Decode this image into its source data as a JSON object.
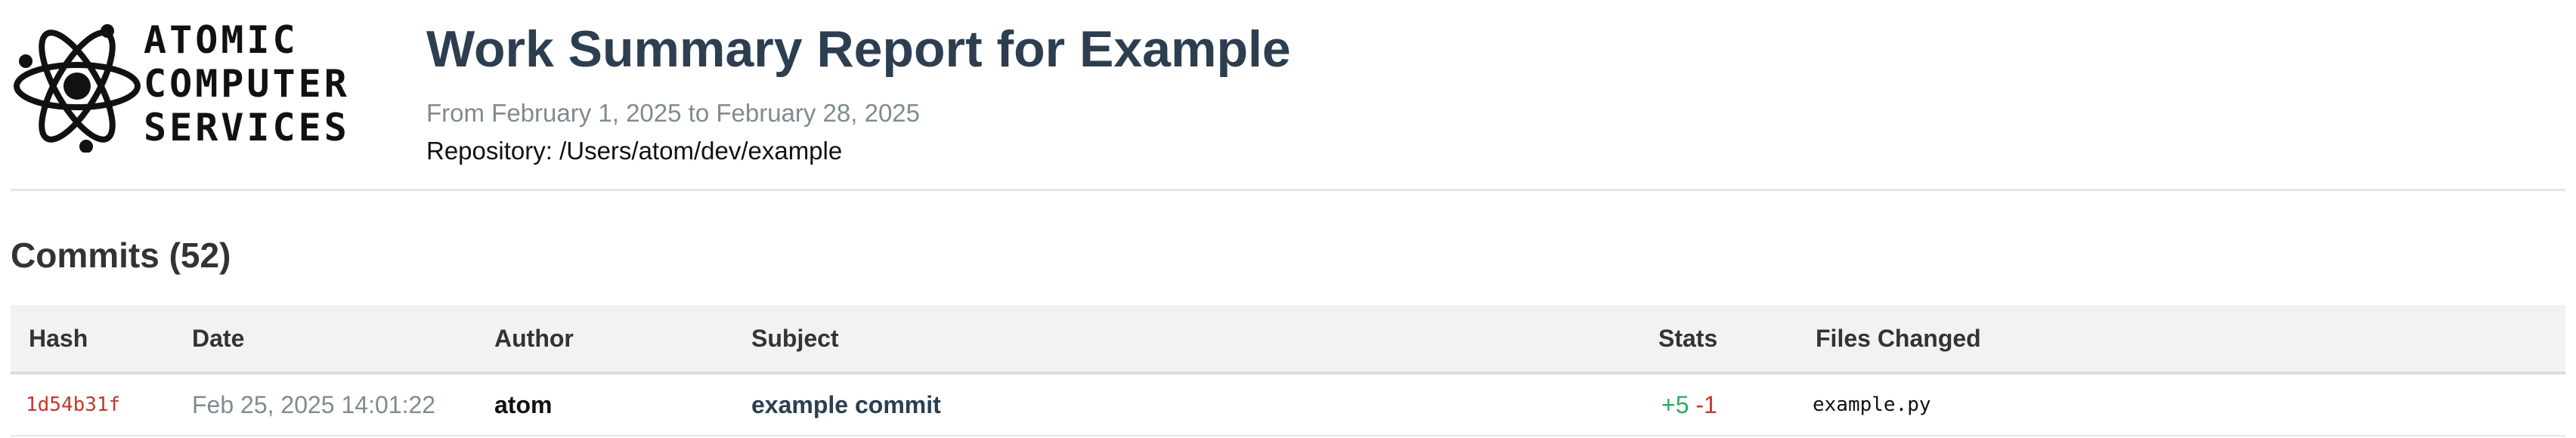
{
  "logo": {
    "icon": "atom-icon",
    "lines": [
      "ATOMIC",
      "COMPUTER",
      "SERVICES"
    ]
  },
  "report": {
    "title": "Work Summary Report for Example",
    "date_range": "From February 1, 2025 to February 28, 2025",
    "repository": "Repository: /Users/atom/dev/example"
  },
  "commits": {
    "heading": "Commits (52)",
    "columns": [
      "Hash",
      "Date",
      "Author",
      "Subject",
      "Stats",
      "Files Changed"
    ],
    "rows": [
      {
        "hash": "1d54b31f",
        "date": "Feb 25, 2025 14:01:22",
        "author": "atom",
        "subject": "example commit",
        "additions": "+5",
        "deletions": "-1",
        "files": "example.py"
      }
    ]
  },
  "colors": {
    "title": "#2c3e50",
    "muted": "#7f8c8d",
    "hash": "#c0392b",
    "additions": "#27ae60",
    "deletions": "#c0392b",
    "header_bg": "#f2f2f2"
  }
}
